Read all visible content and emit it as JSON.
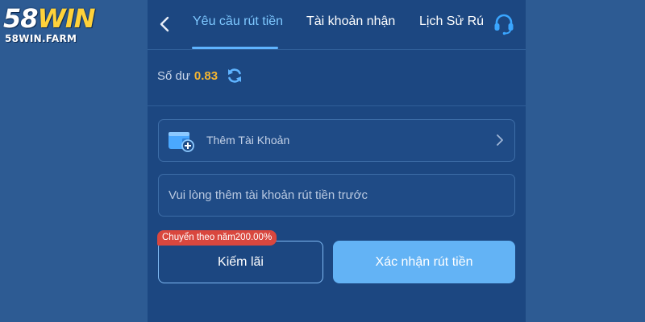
{
  "logo": {
    "main_num": "58",
    "main_win": "WIN",
    "sub": "58WIN.FARM"
  },
  "header": {
    "back_icon": "chevron-left-icon",
    "tabs": [
      {
        "label": "Yêu cầu rút tiền",
        "active": true
      },
      {
        "label": "Tài khoản nhận",
        "active": false
      },
      {
        "label": "Lịch Sử Rú",
        "active": false
      }
    ],
    "support_icon": "headset-icon"
  },
  "balance": {
    "label": "Số dư",
    "value": "0.83",
    "refresh_icon": "refresh-icon"
  },
  "add_account": {
    "icon": "wallet-add-icon",
    "label": "Thêm Tài Khoản",
    "chevron_icon": "chevron-right-icon"
  },
  "hint": {
    "text": "Vui lòng thêm tài khoản rút tiền trước"
  },
  "actions": {
    "promo_badge": "Chuyển theo năm200.00%",
    "earn_label": "Kiếm lãi",
    "confirm_label": "Xác nhận rút tiền"
  },
  "colors": {
    "page_bg": "#2d5b93",
    "panel_bg": "#1c4781",
    "accent": "#63b3f5",
    "active_tab": "#7ec8ff",
    "balance": "#f5b630",
    "badge": "#d9473e"
  }
}
